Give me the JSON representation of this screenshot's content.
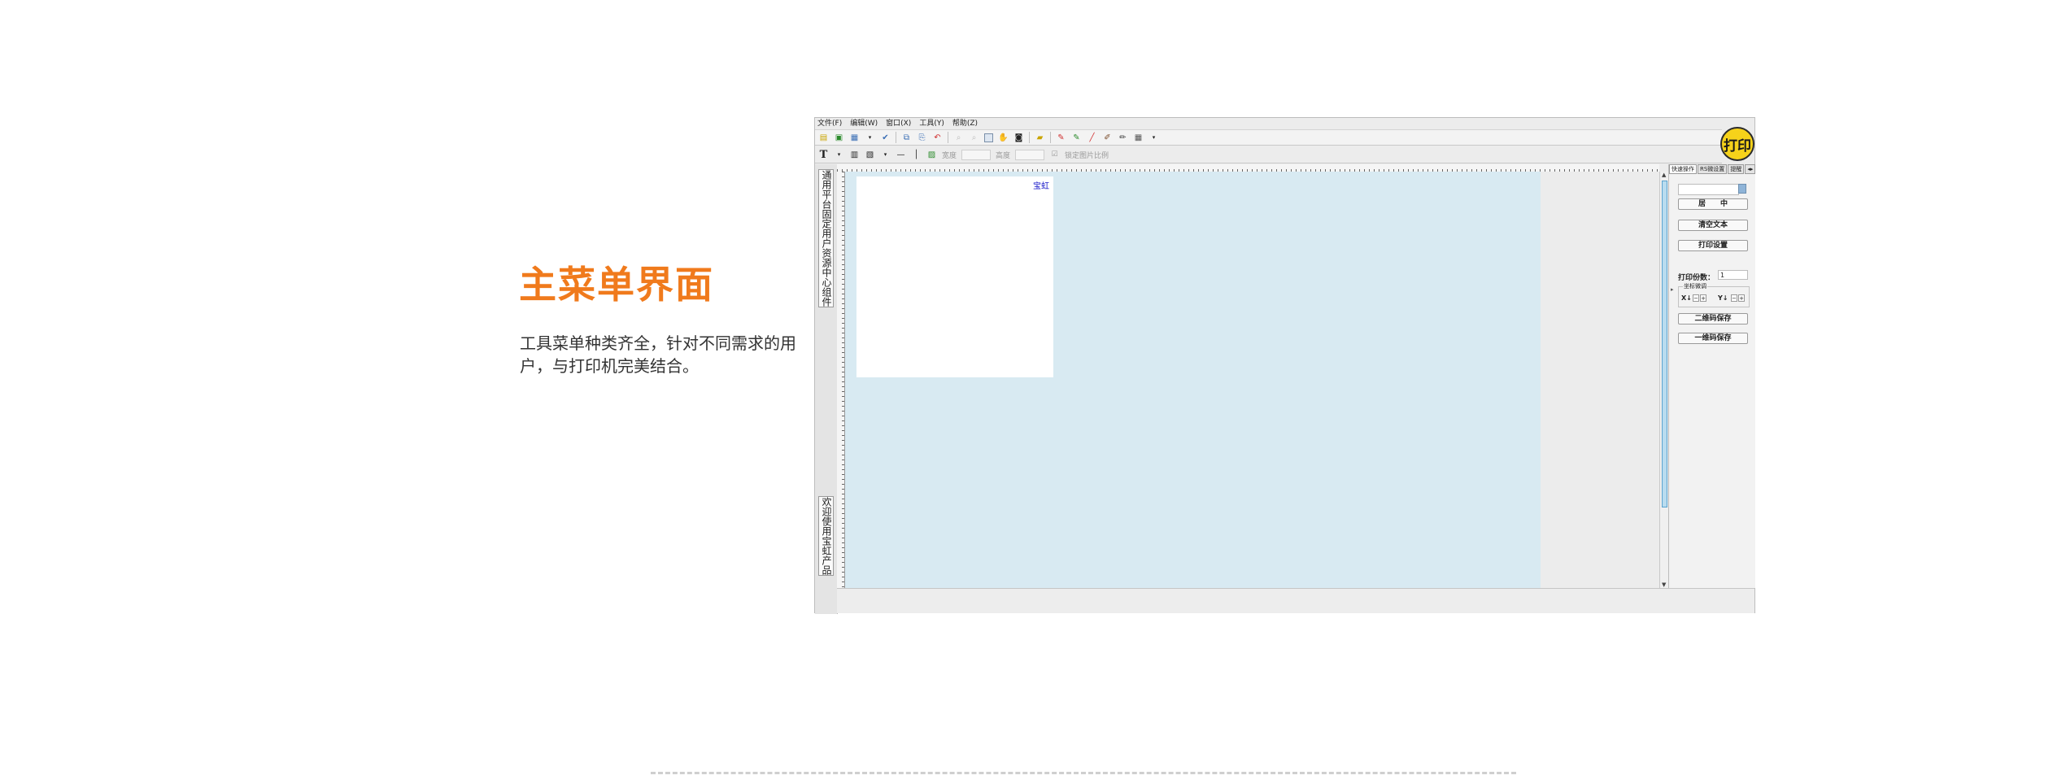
{
  "promo": {
    "title": "主菜单界面",
    "description": "工具菜单种类齐全，针对不同需求的用户，与打印机完美结合。"
  },
  "app": {
    "menu": [
      "文件(F)",
      "编辑(W)",
      "窗口(X)",
      "工具(Y)",
      "帮助(Z)"
    ],
    "toolbar2": {
      "width_label": "宽度",
      "height_label": "高度",
      "lock_label": "锁定图片比例"
    },
    "print_button": "打印",
    "vertical_tabs": [
      "通用平台固定用户资源中心组件",
      "欢迎使用宝虹产品"
    ],
    "canvas": {
      "label_text": "宝虹"
    },
    "right_panel": {
      "tabs": [
        "快速操作",
        "RS微设置",
        "提醒"
      ],
      "buttons": {
        "center": "居　　中",
        "clear_text": "清空文本",
        "print_settings": "打印设置",
        "qr_save": "二维码保存",
        "barcode_save": "一维码保存"
      },
      "copies_label": "打印份数：",
      "copies_value": "1",
      "coord_title": "坐标微调",
      "x_label": "X↓",
      "y_label": "Y↓",
      "minus": "−",
      "plus": "+"
    }
  }
}
